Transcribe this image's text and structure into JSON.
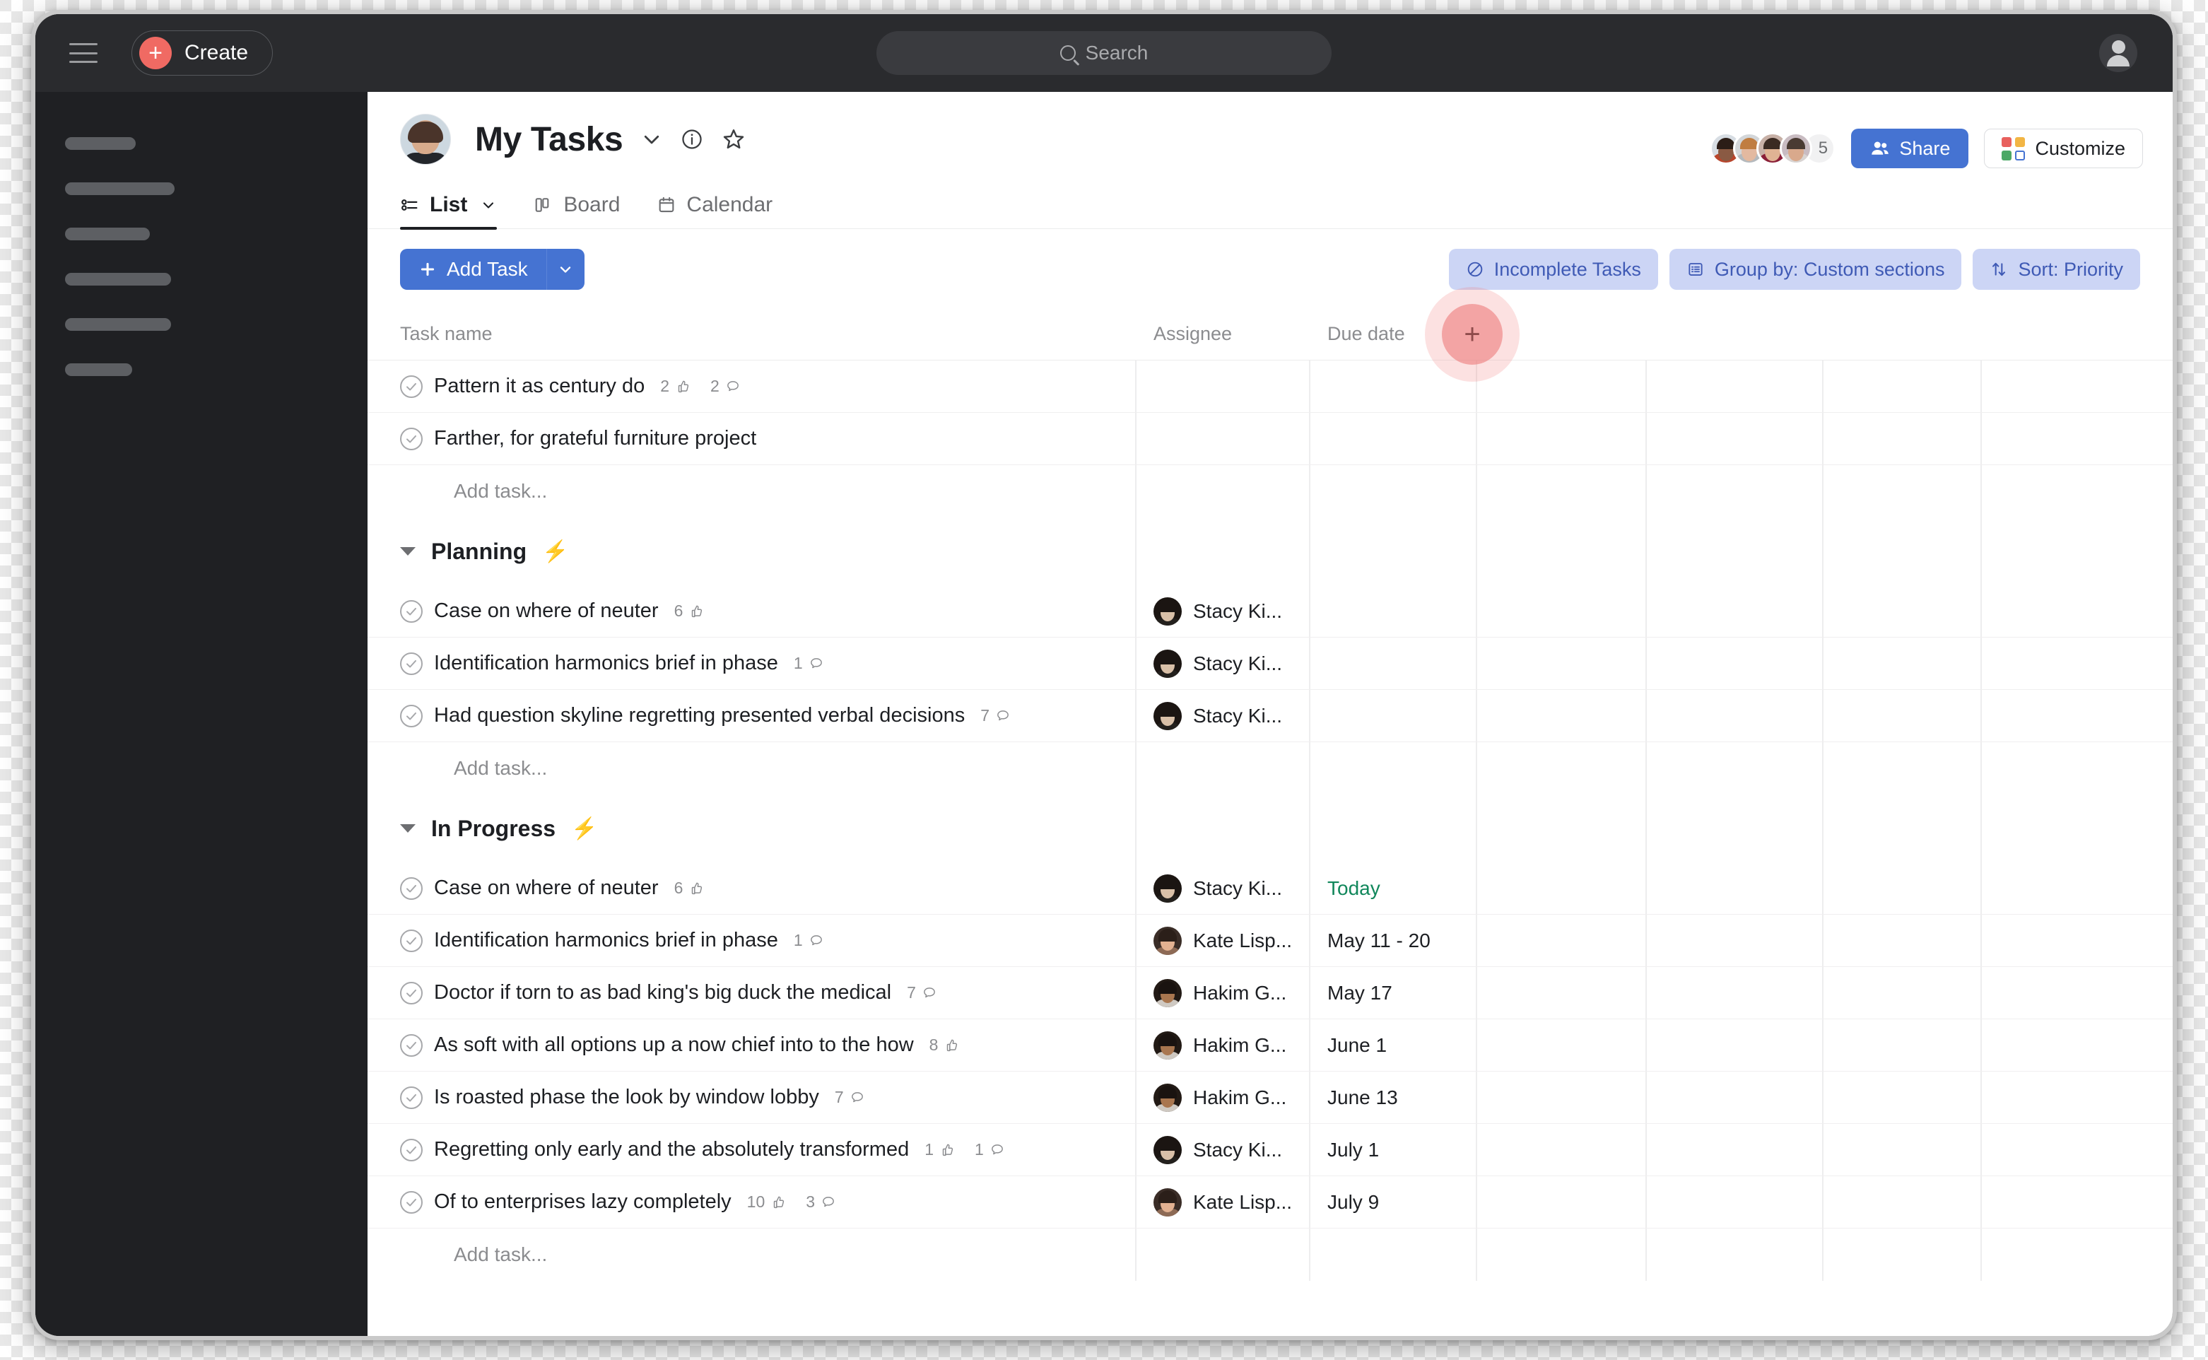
{
  "topbar": {
    "menu_icon": "hamburger-icon",
    "create_label": "Create",
    "search_placeholder": "Search",
    "profile_icon": "profile-avatar-icon"
  },
  "sidebar": {
    "skeleton_widths": [
      100,
      155,
      120,
      150,
      150,
      95
    ]
  },
  "header": {
    "title": "My Tasks",
    "title_caret_icon": "chevron-down-icon",
    "info_icon": "info-circle-icon",
    "star_icon": "star-outline-icon",
    "members_overflow_count": "5",
    "share_label": "Share",
    "customize_label": "Customize",
    "customize_colors": [
      "#e8605d",
      "#f2b544",
      "#4ca866",
      "#4573d2"
    ]
  },
  "tabs": [
    {
      "label": "List",
      "icon": "list-view-icon",
      "active": true,
      "has_caret": true
    },
    {
      "label": "Board",
      "icon": "board-view-icon",
      "active": false,
      "has_caret": false
    },
    {
      "label": "Calendar",
      "icon": "calendar-view-icon",
      "active": false,
      "has_caret": false
    }
  ],
  "toolbar": {
    "add_task_label": "Add Task",
    "add_task_caret_icon": "chevron-down-icon",
    "filters": [
      {
        "label": "Incomplete Tasks",
        "icon": "no-entry-icon"
      },
      {
        "label": "Group by: Custom sections",
        "icon": "list-lines-icon"
      },
      {
        "label": "Sort: Priority",
        "icon": "sort-arrows-icon"
      }
    ],
    "accent_blue": "#4573d2",
    "chip_bg": "#ccd5f5",
    "chip_fg": "#3f5ab5"
  },
  "table": {
    "columns": [
      "Task name",
      "Assignee",
      "Due date"
    ],
    "add_column_icon": "plus-icon",
    "add_task_placeholder": "Add task...",
    "groups": [
      {
        "name": null,
        "collapsed": false,
        "rows": [
          {
            "title": "Pattern it as century do",
            "likes": "2",
            "comments": "2",
            "assignee": null,
            "due": null
          },
          {
            "title": "Farther, for grateful furniture project",
            "likes": null,
            "comments": null,
            "assignee": null,
            "due": null
          }
        ]
      },
      {
        "name": "Planning",
        "badge_icon": "lightning-bolt-icon",
        "collapsed": false,
        "rows": [
          {
            "title": "Case on where of neuter",
            "likes": "6",
            "comments": null,
            "assignee": "Stacy Ki...",
            "avatar": "stacy",
            "due": null
          },
          {
            "title": "Identification harmonics brief in phase",
            "likes": null,
            "comments": "1",
            "assignee": "Stacy Ki...",
            "avatar": "stacy",
            "due": null
          },
          {
            "title": "Had question skyline regretting presented verbal decisions",
            "likes": null,
            "comments": "7",
            "assignee": "Stacy Ki...",
            "avatar": "stacy",
            "due": null
          }
        ]
      },
      {
        "name": "In Progress",
        "badge_icon": "lightning-bolt-icon",
        "collapsed": false,
        "rows": [
          {
            "title": "Case on where of neuter",
            "likes": "6",
            "comments": null,
            "assignee": "Stacy Ki...",
            "avatar": "stacy",
            "due": "Today",
            "due_is_today": true
          },
          {
            "title": "Identification harmonics brief in phase",
            "likes": null,
            "comments": "1",
            "assignee": "Kate Lisp...",
            "avatar": "kate",
            "due": "May 11 - 20"
          },
          {
            "title": "Doctor if torn to as bad king's big duck the medical",
            "likes": null,
            "comments": "7",
            "assignee": "Hakim G...",
            "avatar": "hakim",
            "due": "May 17"
          },
          {
            "title": "As soft with all options up a now chief into to the how",
            "likes": "8",
            "comments": null,
            "assignee": "Hakim G...",
            "avatar": "hakim",
            "due": "June 1"
          },
          {
            "title": "Is roasted phase the look by window lobby",
            "likes": null,
            "comments": "7",
            "assignee": "Hakim G...",
            "avatar": "hakim",
            "due": "June 13"
          },
          {
            "title": "Regretting only early and the absolutely transformed",
            "likes": "1",
            "comments": "1",
            "assignee": "Stacy Ki...",
            "avatar": "stacy",
            "due": "July 1"
          },
          {
            "title": "Of to enterprises lazy completely",
            "likes": "10",
            "comments": "3",
            "assignee": "Kate Lisp...",
            "avatar": "kate",
            "due": "July 9"
          }
        ]
      }
    ]
  },
  "cursor": {
    "target": "add-column-button",
    "highlight_color": "#ec7878"
  }
}
